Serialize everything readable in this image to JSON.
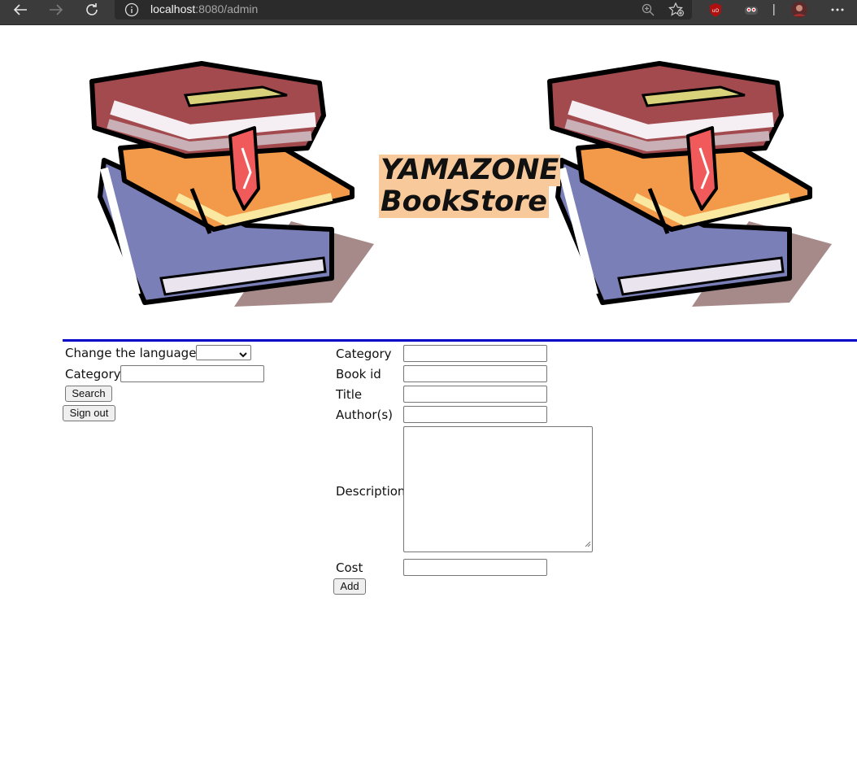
{
  "browser": {
    "url_host": "localhost",
    "url_rest": ":8080/admin"
  },
  "header": {
    "title_line1": "YAMAZONE",
    "title_line2": "BookStore"
  },
  "sidebar": {
    "language_label": "Change the language:",
    "language_value": "",
    "category_label": "Category",
    "category_value": "",
    "search_label": "Search",
    "signout_label": "Sign out"
  },
  "add_book_form": {
    "category_label": "Category",
    "book_id_label": "Book id",
    "title_label": "Title",
    "authors_label": "Author(s)",
    "description_label": "Description",
    "cost_label": "Cost",
    "add_label": "Add",
    "category_value": "",
    "book_id_value": "",
    "title_value": "",
    "authors_value": "",
    "description_value": "",
    "cost_value": ""
  },
  "colors": {
    "rule": "#0000c8",
    "title_highlight": "#f8c99a",
    "chrome_bg": "#3b3b3b"
  },
  "icons": [
    "back-arrow-icon",
    "forward-arrow-icon",
    "refresh-icon",
    "info-icon",
    "zoom-icon",
    "favorites-icon",
    "ublock-icon",
    "extension-icon",
    "profile-avatar",
    "more-icon"
  ]
}
